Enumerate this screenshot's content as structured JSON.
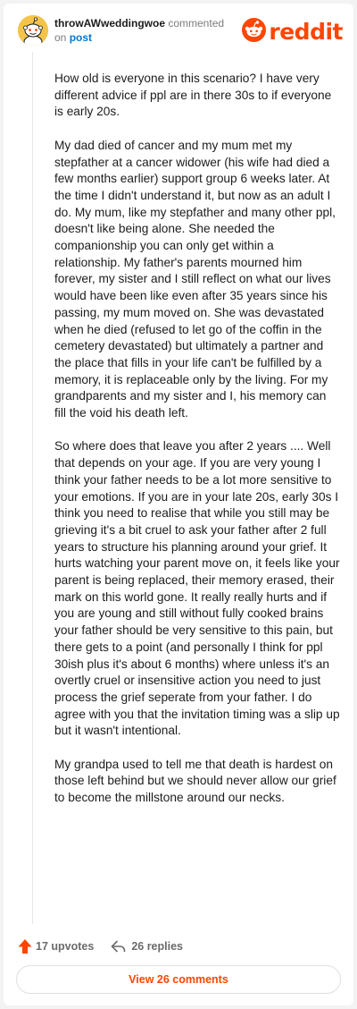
{
  "comment": {
    "username": "throwAWweddingwoe",
    "action_text": "commented",
    "on_text": "on",
    "post_link_text": "post"
  },
  "brand": {
    "name": "reddit",
    "color": "#ff4500"
  },
  "body": {
    "paragraphs": [
      "How old is everyone in this scenario? I have very different advice if ppl are in there 30s to if everyone is early 20s.",
      "My dad died of cancer and my mum met my stepfather at a cancer widower (his wife had died a few months earlier) support group 6 weeks later. At the time I didn't understand it, but now as an adult I do. My mum, like my stepfather and many other ppl, doesn't like being alone. She needed the companionship you can only get within a relationship. My father's parents mourned him forever, my sister and I still reflect on what our lives would have been like even after 35 years since his passing, my mum moved on. She was devastated when he died (refused to let go of the coffin in the cemetery devastated) but ultimately a partner and the place that fills in your life can't be fulfilled by a memory, it is replaceable only by the living. For my grandparents and my sister and I, his memory can fill the void his death left.",
      "So where does that leave you after 2 years .... Well that depends on your age. If you are very young I think your father needs to be a lot more sensitive to your emotions. If you are in your late 20s, early 30s I think you need to realise that while you still may be grieving it's a bit cruel to ask your father after 2 full years to structure his planning around your grief. It hurts watching your parent move on, it feels like your parent is being replaced, their memory erased, their mark on this world gone. It really really hurts and if you are young and still without fully cooked brains your father should be very sensitive to this pain, but there gets to a point (and personally I think for ppl 30ish plus it's about 6 months) where unless it's an overtly cruel or insensitive action you need to just process the grief seperate from your father. I do agree with you that the invitation timing was a slip up but it wasn't intentional.",
      "My grandpa used to tell me that death is hardest on those left behind but we should never allow our grief to become the millstone around our necks."
    ]
  },
  "footer": {
    "upvotes_label": "17 upvotes",
    "replies_label": "26 replies",
    "view_button_label": "View 26 comments"
  },
  "icons": {
    "avatar": "snoo-avatar-icon",
    "logo": "reddit-logo-icon",
    "upvote": "upvote-arrow-icon",
    "reply": "reply-arrow-icon"
  },
  "colors": {
    "accent": "#ff4500",
    "link": "#0079d3",
    "text": "#1c1c1c",
    "muted": "#7c7c7c",
    "background": "#f3f3f3",
    "card": "#ffffff"
  }
}
